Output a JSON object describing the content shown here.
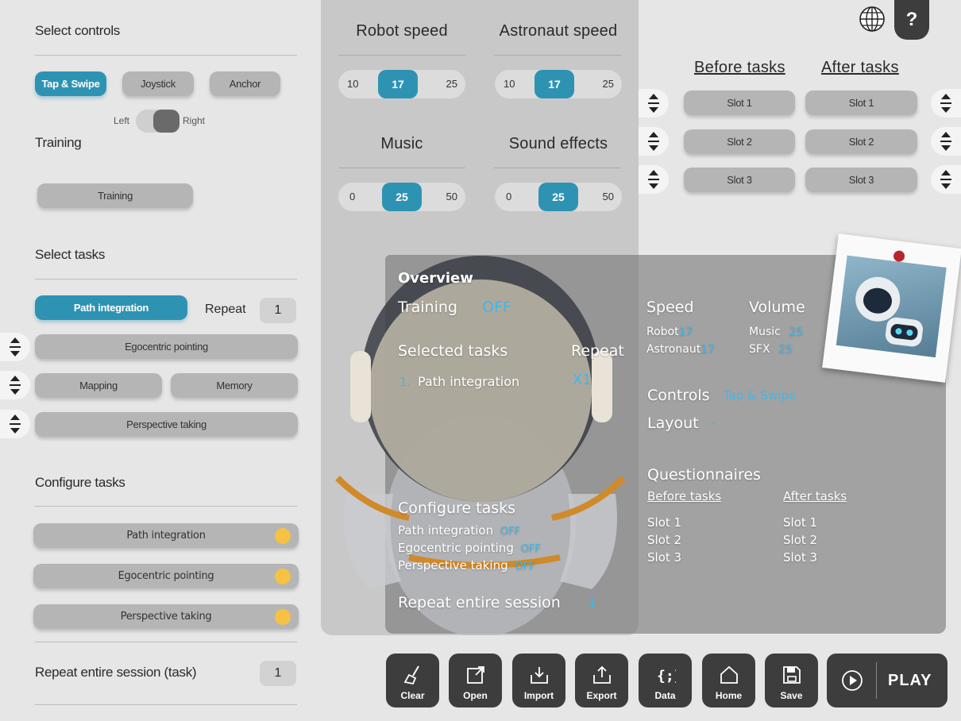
{
  "left": {
    "select_controls": "Select controls",
    "controls": [
      "Tap & Swipe",
      "Joystick",
      "Anchor"
    ],
    "toggle_left": "Left",
    "toggle_right": "Right",
    "training_heading": "Training",
    "training_button": "Training",
    "select_tasks": "Select tasks",
    "path_integration": "Path integration",
    "repeat_label": "Repeat",
    "repeat_value": "1",
    "egocentric": "Egocentric pointing",
    "mapping": "Mapping",
    "memory": "Memory",
    "perspective": "Perspective taking",
    "configure_tasks": "Configure tasks",
    "configure_items": [
      "Path integration",
      "Egocentric pointing",
      "Perspective taking"
    ],
    "repeat_session_label": "Repeat entire session (task)",
    "repeat_session_value": "1"
  },
  "sliders": {
    "robot": {
      "title": "Robot speed",
      "min": "10",
      "value": "17",
      "max": "25"
    },
    "astronaut": {
      "title": "Astronaut speed",
      "min": "10",
      "value": "17",
      "max": "25"
    },
    "music": {
      "title": "Music",
      "min": "0",
      "value": "25",
      "max": "50"
    },
    "sfx": {
      "title": "Sound effects",
      "min": "0",
      "value": "25",
      "max": "50"
    }
  },
  "questionnaires": {
    "before_heading": "Before tasks",
    "after_heading": "After tasks",
    "before": [
      "Slot 1",
      "Slot 2",
      "Slot 3"
    ],
    "after": [
      "Slot 1",
      "Slot 2",
      "Slot 3"
    ]
  },
  "overview": {
    "title": "Overview",
    "training_label": "Training",
    "training_value": "OFF",
    "selected_tasks": "Selected tasks",
    "repeat": "Repeat",
    "task_num": "1.",
    "task_name": "Path integration",
    "task_repeat": "X1",
    "configure_tasks": "Configure tasks",
    "config": [
      {
        "name": "Path integration",
        "value": "OFF"
      },
      {
        "name": "Egocentric pointing",
        "value": "OFF"
      },
      {
        "name": "Perspective taking",
        "value": "OFF"
      }
    ],
    "repeat_session": "Repeat entire session",
    "repeat_session_value": "1",
    "speed": "Speed",
    "robot_label": "Robot",
    "robot_value": "17",
    "astronaut_label": "Astronaut",
    "astronaut_value": "17",
    "volume": "Volume",
    "music_label": "Music",
    "music_value": "25",
    "sfx_label": "SFX",
    "sfx_value": "25",
    "controls_label": "Controls",
    "controls_value": "Tap & Swipe",
    "layout_label": "Layout",
    "layout_value": "-",
    "questionnaires": "Questionnaires",
    "before": "Before tasks",
    "after": "After tasks",
    "before_slots": [
      "Slot 1",
      "Slot 2",
      "Slot 3"
    ],
    "after_slots": [
      "Slot 1",
      "Slot 2",
      "Slot 3"
    ]
  },
  "toolbar": {
    "clear": "Clear",
    "open": "Open",
    "import": "Import",
    "export": "Export",
    "data": "Data",
    "home": "Home",
    "save": "Save",
    "play": "PLAY"
  },
  "help": "?",
  "colors": {
    "accent": "#2e93b3",
    "overview_accent": "#43b6e6",
    "dark_button": "#3d3d3d",
    "config_dot": "#f5c243"
  }
}
